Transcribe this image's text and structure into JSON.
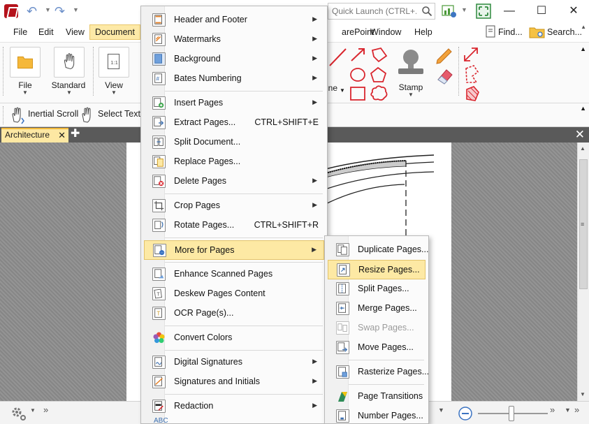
{
  "quick_access": {
    "undo_icon": "undo-icon",
    "redo_icon": "redo-icon"
  },
  "quick_launch": {
    "placeholder": "Quick Launch (CTRL+.)"
  },
  "menubar": {
    "file": "File",
    "edit": "Edit",
    "view": "View",
    "document": "Document",
    "sharepoint": "arePoint",
    "window": "Window",
    "help": "Help",
    "find": "Find...",
    "search": "Search..."
  },
  "ribbon": {
    "file": "File",
    "standard": "Standard",
    "view": "View",
    "line": "ine",
    "stamp": "Stamp",
    "inertial_scroll": "Inertial Scroll",
    "select_text": "Select Text/"
  },
  "tabs": {
    "document_tab": "Architecture"
  },
  "main_menu": {
    "items": [
      {
        "label": "Header and Footer",
        "submenu": true
      },
      {
        "label": "Watermarks",
        "submenu": true
      },
      {
        "label": "Background",
        "submenu": true
      },
      {
        "label": "Bates Numbering",
        "submenu": true
      },
      {
        "label": "Insert Pages",
        "submenu": true
      },
      {
        "label": "Extract Pages...",
        "shortcut": "CTRL+SHIFT+E"
      },
      {
        "label": "Split Document..."
      },
      {
        "label": "Replace Pages..."
      },
      {
        "label": "Delete Pages",
        "submenu": true
      },
      {
        "label": "Crop Pages",
        "submenu": true
      },
      {
        "label": "Rotate Pages...",
        "shortcut": "CTRL+SHIFT+R"
      },
      {
        "label": "More for Pages",
        "submenu": true
      },
      {
        "label": "Enhance Scanned Pages"
      },
      {
        "label": "Deskew Pages Content"
      },
      {
        "label": "OCR Page(s)..."
      },
      {
        "label": "Convert Colors"
      },
      {
        "label": "Digital Signatures",
        "submenu": true
      },
      {
        "label": "Signatures and Initials",
        "submenu": true
      },
      {
        "label": "Redaction",
        "submenu": true
      },
      {
        "label": "ABC"
      }
    ]
  },
  "sub_menu": {
    "items": [
      {
        "label": "Duplicate Pages..."
      },
      {
        "label": "Resize Pages..."
      },
      {
        "label": "Split Pages..."
      },
      {
        "label": "Merge Pages..."
      },
      {
        "label": "Swap Pages..."
      },
      {
        "label": "Move Pages..."
      },
      {
        "label": "Rasterize Pages..."
      },
      {
        "label": "Page Transitions"
      },
      {
        "label": "Number Pages..."
      }
    ]
  },
  "colors": {
    "highlight": "#fde9a4",
    "accent_red": "#d9262e",
    "tab_active": "#fde8a3"
  }
}
